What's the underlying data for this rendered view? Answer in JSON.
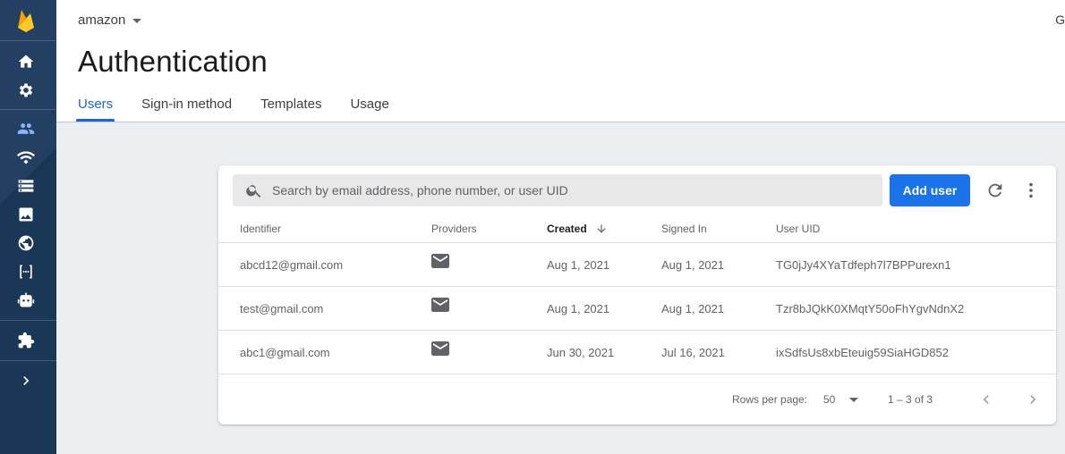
{
  "header": {
    "project_name": "amazon",
    "topright_text": "G",
    "page_title": "Authentication",
    "tabs": [
      {
        "label": "Users",
        "active": true
      },
      {
        "label": "Sign-in method",
        "active": false
      },
      {
        "label": "Templates",
        "active": false
      },
      {
        "label": "Usage",
        "active": false
      }
    ]
  },
  "sidebar": {
    "icons": [
      "firebase-logo",
      "home-icon",
      "settings-icon",
      "users-icon",
      "wifi-icon",
      "storage-icon",
      "image-icon",
      "globe-icon",
      "functions-icon",
      "robot-icon",
      "extensions-icon",
      "chevron-right-icon"
    ]
  },
  "search": {
    "placeholder": "Search by email address, phone number, or user UID"
  },
  "toolbar": {
    "add_user_label": "Add user"
  },
  "table": {
    "columns": [
      "Identifier",
      "Providers",
      "Created",
      "Signed In",
      "User UID"
    ],
    "rows": [
      {
        "identifier": "abcd12@gmail.com",
        "provider": "mail-icon",
        "created": "Aug 1, 2021",
        "signed_in": "Aug 1, 2021",
        "uid": "TG0jJy4XYaTdfeph7l7BPPurexn1"
      },
      {
        "identifier": "test@gmail.com",
        "provider": "mail-icon",
        "created": "Aug 1, 2021",
        "signed_in": "Aug 1, 2021",
        "uid": "Tzr8bJQkK0XMqtY50oFhYgvNdnX2"
      },
      {
        "identifier": "abc1@gmail.com",
        "provider": "mail-icon",
        "created": "Jun 30, 2021",
        "signed_in": "Jul 16, 2021",
        "uid": "ixSdfsUs8xbEteuig59SiaHGD852"
      }
    ]
  },
  "pagination": {
    "rows_per_page_label": "Rows per page:",
    "rows_per_page_value": "50",
    "range": "1 – 3 of 3"
  },
  "colors": {
    "sidebar": "#1c3a5e",
    "accent": "#1a73e8",
    "active_tab": "#1967d2"
  }
}
